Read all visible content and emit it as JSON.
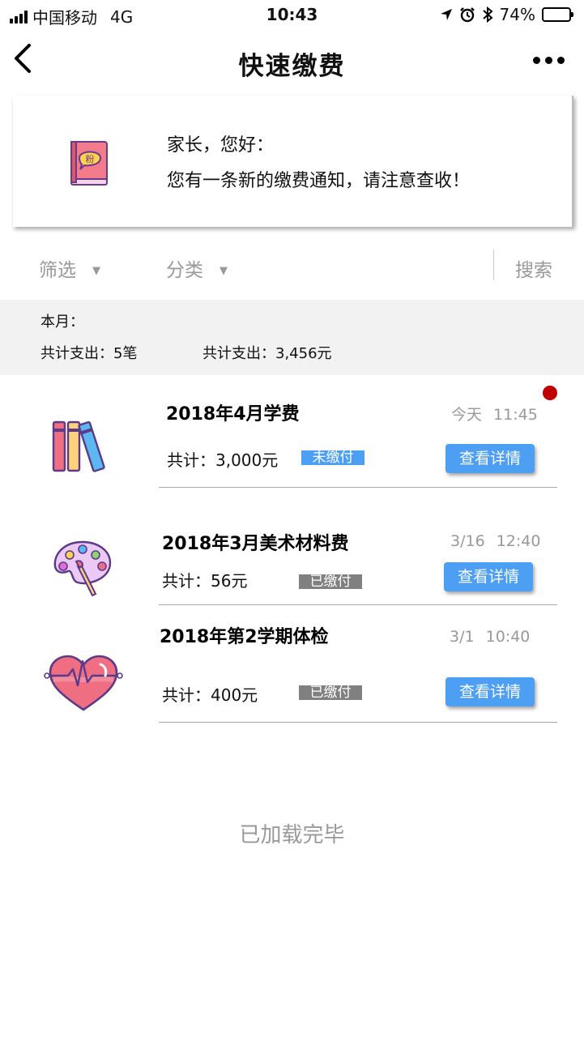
{
  "status_bar": {
    "carrier": "中国移动",
    "network": "4G",
    "time": "10:43",
    "battery": "74%",
    "battery_level": 0.74,
    "icons": [
      "signal-icon",
      "location-arrow-icon",
      "alarm-icon",
      "bluetooth-icon",
      "battery-icon"
    ]
  },
  "nav": {
    "title": "快速缴费",
    "back_icon": "chevron-left-icon",
    "more_icon": "more-dots-icon"
  },
  "notice": {
    "greeting": "家长，您好：",
    "message": "您有一条新的缴费通知，请注意查收！",
    "icon": "notebook-icon"
  },
  "filters": {
    "filter_label": "筛选",
    "category_label": "分类",
    "search_label": "搜索"
  },
  "summary": {
    "month_label": "本月：",
    "count_text": "共计支出：5笔",
    "amount_text": "共计支出：3,456元"
  },
  "items": [
    {
      "title": "2018年4月学费",
      "time": "今天 11:45",
      "total": "共计：3,000元",
      "status": "未缴付",
      "button": "查看详情",
      "icon": "books-icon",
      "unread": true
    },
    {
      "title": "2018年3月美术材料费",
      "time": "3/16 12:40",
      "total": "共计：56元",
      "status": "已缴付",
      "button": "查看详情",
      "icon": "palette-icon",
      "unread": false
    },
    {
      "title": "2018年第2学期体检",
      "time": "3/1 10:40",
      "total": "共计：400元",
      "status": "已缴付",
      "button": "查看详情",
      "icon": "heart-pulse-icon",
      "unread": false
    }
  ],
  "footer": {
    "end_text": "已加载完毕"
  },
  "colors": {
    "accent": "#4d9ff4",
    "paid_badge": "#808080",
    "unread_dot": "#c00000",
    "summary_bg": "#f2f2f2"
  }
}
